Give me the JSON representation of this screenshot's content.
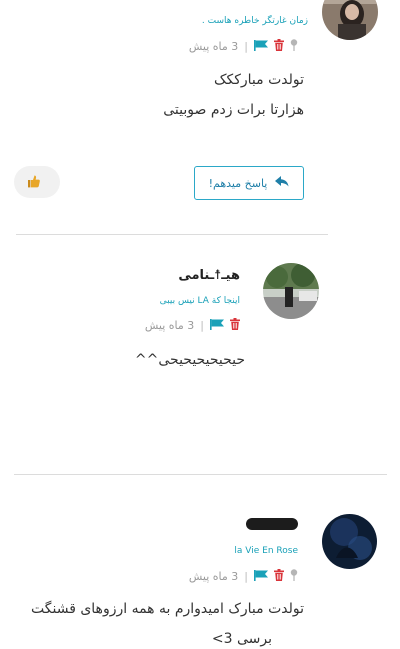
{
  "comments": [
    {
      "subtitle": "زمان غارتگر خاطره هاست .",
      "time": "3 ماه پیش",
      "lines": [
        "تولدت مبارککک",
        "هزارتا برات زدم صوبیتی"
      ],
      "reply_label": "پاسخ میدهم!"
    },
    {
      "username": "هیـ☨ـنامی",
      "subtitle": "اینجا کة LA نیس بیبی",
      "time": "3 ماه پیش",
      "lines": [
        "حیحیحیحیحیحی^^"
      ]
    },
    {
      "subtitle": "la Vie En Rose",
      "time": "3 ماه پیش",
      "lines": [
        "تولدت مبارک امیدوارم به همه ارزوهای قشنگت",
        "برسی 3>"
      ]
    }
  ],
  "colors": {
    "accent": "#1aa1b8",
    "delete": "#d9343a",
    "flag": "#1aa1b8",
    "pin": "#b5b5b5"
  },
  "icons": [
    "pin-icon",
    "delete-icon",
    "flag-icon",
    "reply-arrow-icon",
    "thumbs-up-icon"
  ]
}
